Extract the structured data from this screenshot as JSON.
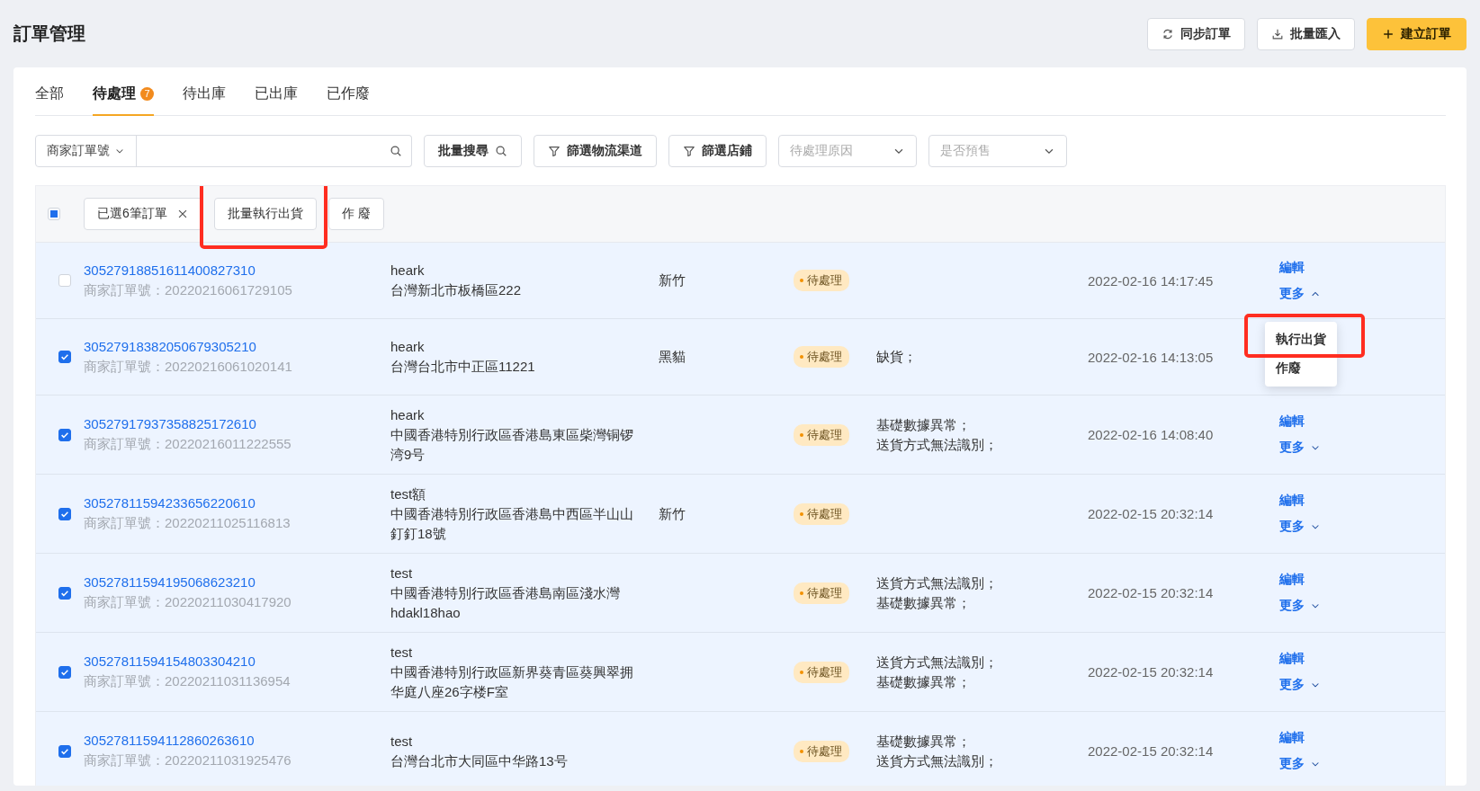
{
  "page": {
    "title": "訂單管理"
  },
  "header_buttons": [
    {
      "label": "同步訂單",
      "kind": "sync"
    },
    {
      "label": "批量匯入",
      "kind": "import"
    },
    {
      "label": "建立訂單",
      "kind": "create"
    }
  ],
  "tabs": [
    {
      "label": "全部",
      "selected": false
    },
    {
      "label": "待處理",
      "selected": true,
      "badge": "7"
    },
    {
      "label": "待出庫",
      "selected": false
    },
    {
      "label": "已出庫",
      "selected": false
    },
    {
      "label": "已作廢",
      "selected": false
    }
  ],
  "filters": [
    {
      "kind": "select",
      "label": "商家訂單號"
    },
    {
      "kind": "search"
    },
    {
      "kind": "search_button",
      "label": "批量搜尋"
    },
    {
      "kind": "filter_button",
      "label": "篩選物流渠道"
    },
    {
      "kind": "filter_button",
      "label": "篩選店鋪"
    },
    {
      "kind": "dropdown",
      "placeholder": "待處理原因"
    },
    {
      "kind": "dropdown",
      "placeholder": "是否預售"
    }
  ],
  "bulk_bar": {
    "select_all_partial": true,
    "selection_tag": "已選6筆訂單",
    "actions": [
      {
        "label": "批量執行出貨",
        "highlighted": true
      },
      {
        "label": "作 廢",
        "highlighted": false
      }
    ]
  },
  "rows": [
    {
      "checked": false,
      "order_no": "30527918851611400827310",
      "merchant_no": "商家訂單號：20220216061729105",
      "recipient": "heark",
      "address": "台灣新北市板橋區222",
      "logistics": "新竹",
      "status": "待處理",
      "reasons": [],
      "time": "2022-02-16 14:17:45",
      "edit": "編輯",
      "more": "更多",
      "expanded": true,
      "menu": [
        {
          "label": "執行出貨",
          "highlighted": true
        },
        {
          "label": "作廢",
          "highlighted": false
        }
      ]
    },
    {
      "checked": true,
      "order_no": "30527918382050679305210",
      "merchant_no": "商家訂單號：20220216061020141",
      "recipient": "heark",
      "address": "台灣台北市中正區11221",
      "logistics": "黑貓",
      "status": "待處理",
      "reasons": [
        "缺貨；"
      ],
      "time": "2022-02-16 14:13:05"
    },
    {
      "checked": true,
      "order_no": "30527917937358825172610",
      "merchant_no": "商家訂單號：20220216011222555",
      "recipient": "heark",
      "address": "中國香港特別行政區香港島東區柴灣铜锣湾9号",
      "logistics": "",
      "status": "待處理",
      "reasons": [
        "基礎數據異常；",
        "送貨方式無法識別；"
      ],
      "time": "2022-02-16 14:08:40",
      "edit": "編輯",
      "more": "更多",
      "expanded": false
    },
    {
      "checked": true,
      "order_no": "30527811594233656220610",
      "merchant_no": "商家訂單號：20220211025116813",
      "recipient": "test額",
      "address": "中國香港特別行政區香港島中西區半山山釘釘18號",
      "logistics": "新竹",
      "status": "待處理",
      "reasons": [],
      "time": "2022-02-15 20:32:14",
      "edit": "編輯",
      "more": "更多",
      "expanded": false
    },
    {
      "checked": true,
      "order_no": "30527811594195068623210",
      "merchant_no": "商家訂單號：20220211030417920",
      "recipient": "test",
      "address": "中國香港特別行政區香港島南區淺水灣hdakl18hao",
      "logistics": "",
      "status": "待處理",
      "reasons": [
        "送貨方式無法識別；",
        "基礎數據異常；"
      ],
      "time": "2022-02-15 20:32:14",
      "edit": "編輯",
      "more": "更多",
      "expanded": false
    },
    {
      "checked": true,
      "order_no": "30527811594154803304210",
      "merchant_no": "商家訂單號：20220211031136954",
      "recipient": "test",
      "address": "中國香港特別行政區新界葵青區葵興翠拥华庭八座26字楼F室",
      "logistics": "",
      "status": "待處理",
      "reasons": [
        "送貨方式無法識別；",
        "基礎數據異常；"
      ],
      "time": "2022-02-15 20:32:14",
      "edit": "編輯",
      "more": "更多",
      "expanded": false
    },
    {
      "checked": true,
      "order_no": "30527811594112860263610",
      "merchant_no": "商家訂單號：20220211031925476",
      "recipient": "test",
      "address": "台灣台北市大同區中华路13号",
      "logistics": "",
      "status": "待處理",
      "reasons": [
        "基礎數據異常；",
        "送貨方式無法識別；"
      ],
      "time": "2022-02-15 20:32:14",
      "edit": "編輯",
      "more": "更多",
      "expanded": false
    }
  ]
}
